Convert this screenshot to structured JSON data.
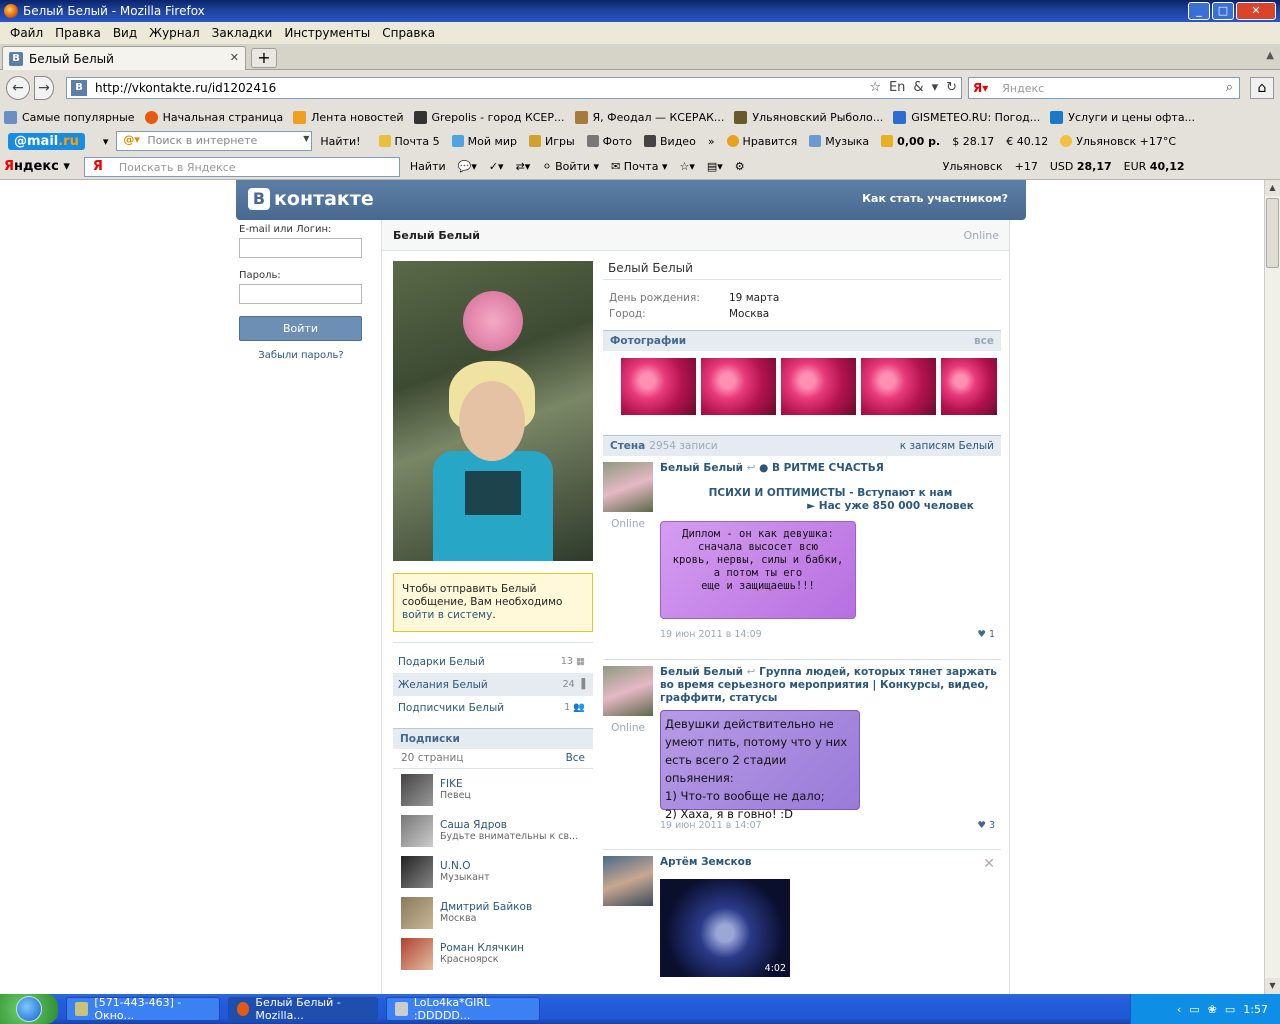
{
  "window": {
    "title": "Белый Белый - Mozilla Firefox"
  },
  "menu": [
    "Файл",
    "Правка",
    "Вид",
    "Журнал",
    "Закладки",
    "Инструменты",
    "Справка"
  ],
  "tab": {
    "label": "Белый Белый"
  },
  "nav": {
    "url": "http://vkontakte.ru/id1202416",
    "search_placeholder": "Яндекс"
  },
  "bookmarks": [
    "Самые популярные",
    "Начальная страница",
    "Лента новостей",
    "Grepolis - город КСЕР...",
    "Я, Феодал — КСЕРАК...",
    "Ульяновский Рыболо...",
    "GISMETEO.RU: Погод...",
    "Услуги и цены офта..."
  ],
  "mailbar": {
    "logo_left": "@mail",
    "logo_right": ".ru",
    "search_placeholder": "Поиск в интернете",
    "find": "Найти!",
    "items": [
      "Почта 5",
      "Мой мир",
      "Игры",
      "Фото",
      "Видео",
      "»",
      "Нравится",
      "Музыка",
      "0,00 р.",
      "$ 28.17",
      "€ 40.12",
      "Ульяновск +17°C"
    ]
  },
  "yabar": {
    "logo_a": "Я",
    "logo_b": "ндекс",
    "search_placeholder": "Поискать в Яндексе",
    "find": "Найти",
    "items": [
      "Войти",
      "Почта"
    ],
    "city": "Ульяновск",
    "temp": "+17",
    "usd_label": "USD",
    "usd": "28,17",
    "eur_label": "EUR",
    "eur": "40,12"
  },
  "vk": {
    "logo": "контакте",
    "logo_letter": "В",
    "join": "Как стать участником?",
    "login": {
      "email_label": "E-mail или Логин:",
      "password_label": "Пароль:",
      "button": "Войти",
      "forgot": "Забыли пароль?"
    },
    "profile": {
      "name": "Белый Белый",
      "status": "Online",
      "info": [
        {
          "key": "День рождения:",
          "value": "19 марта"
        },
        {
          "key": "Город:",
          "value": "Москва"
        }
      ]
    },
    "message_box": {
      "text": "Чтобы отправить Белый сообщение, Вам необходимо ",
      "link": "войти в систему",
      "end": "."
    },
    "links": [
      {
        "label": "Подарки Белый",
        "count": "13"
      },
      {
        "label": "Желания Белый",
        "count": "24"
      },
      {
        "label": "Подписчики Белый",
        "count": "1"
      }
    ],
    "subscriptions": {
      "title": "Подписки",
      "count": "20 страниц",
      "all": "Все",
      "items": [
        {
          "name": "FIKE",
          "desc": "Певец"
        },
        {
          "name": "Саша Ядров",
          "desc": "Будьте внимательны к св..."
        },
        {
          "name": "U.N.O",
          "desc": "Музыкант"
        },
        {
          "name": "Дмитрий Байков",
          "desc": "Москва"
        },
        {
          "name": "Роман Клячкин",
          "desc": "Красноярск"
        }
      ]
    },
    "photos": {
      "title": "Фотографии",
      "all": "все"
    },
    "wall": {
      "title": "Стена",
      "count": "2954 записи",
      "link": "к записям Белый",
      "posts": [
        {
          "author": "Белый Белый",
          "repost": "↩",
          "group": "● В РИТМЕ СЧАСТЬЯ",
          "line1": "ПСИХИ И ОПТИМИСТЫ - Вступают к нам",
          "line2": "► Нас уже 850 000 человек",
          "image_lines": [
            "Диплом - он как девушка:",
            "сначала высосет всю",
            "кровь, нервы, силы и бабки,",
            "а потом ты его",
            "еще и защищаешь!!!"
          ],
          "online": "Online",
          "date": "19 июн 2011 в 14:09",
          "likes": "1"
        },
        {
          "author": "Белый Белый",
          "repost": "↩",
          "group": "Группа людей, которых тянет заржать во время серьезного мероприятия | Конкурсы, видео, граффити, статусы",
          "image_lines": [
            "Девушки действительно не",
            "умеют пить, потому что у них",
            "есть всего 2 стадии опьянения:",
            "1) Что-то вообще не дало;",
            "2) Хаха, я в говно! :D"
          ],
          "online": "Online",
          "date": "19 июн 2011 в 14:07",
          "likes": "3"
        },
        {
          "author": "Артём Земсков",
          "video_duration": "4:02",
          "close": "✕"
        }
      ]
    }
  },
  "taskbar": {
    "tasks": [
      "[571-443-463] - Окно...",
      "Белый Белый - Mozilla...",
      "LoLo4ka*GIRL :DDDDD..."
    ],
    "lang": "RU",
    "time": "1:57"
  }
}
